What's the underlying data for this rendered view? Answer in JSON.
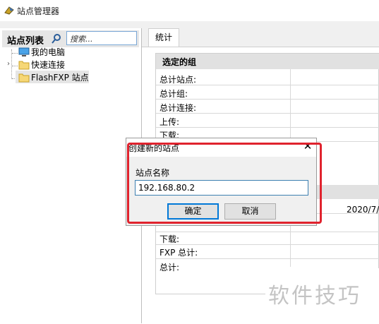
{
  "window": {
    "title": "站点管理器",
    "overlap_title_fragment": "···"
  },
  "left_panel": {
    "title": "站点列表",
    "search_placeholder": "搜索...",
    "tree": [
      {
        "label": "我的电脑",
        "icon": "computer-icon"
      },
      {
        "label": "快速连接",
        "icon": "folder-icon"
      },
      {
        "label": "FlashFXP 站点",
        "icon": "folder-icon"
      }
    ]
  },
  "right_panel": {
    "tab": "统计",
    "group_title": "选定的组",
    "rows": [
      "总计站点:",
      "总计组:",
      "总计连接:",
      "上传:",
      "下载:"
    ],
    "rows_lower": [
      "下载:",
      "FXP 总计:",
      "总计:"
    ],
    "date_value": "2020/7/"
  },
  "dialog": {
    "title": "创建新的站点",
    "close_glyph": "✕",
    "field_label": "站点名称",
    "field_value": "192.168.80.2",
    "ok_label": "确定",
    "cancel_label": "取消"
  },
  "watermark": "软件技巧",
  "colors": {
    "highlight": "#e0232e",
    "focus": "#0078d7",
    "header_gray": "#e1e1e1"
  }
}
